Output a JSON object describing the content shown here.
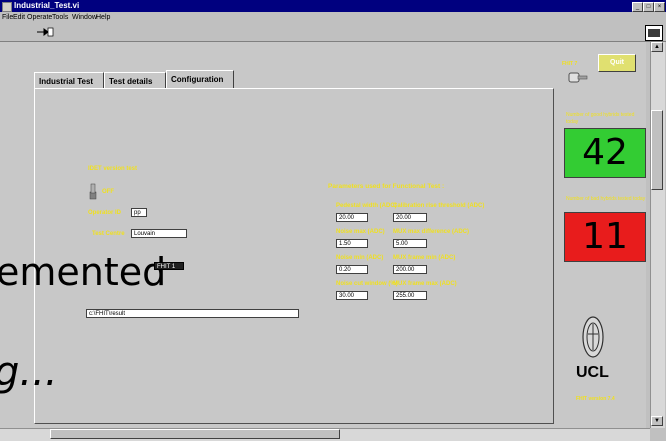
{
  "window": {
    "title": "Industrial_Test.vi"
  },
  "menu": [
    "File",
    "Edit",
    "Operate",
    "Tools",
    "Window",
    "Help"
  ],
  "tabs": [
    "Industrial Test",
    "Test details",
    "Configuration"
  ],
  "quit_label": "Quit",
  "fhit_label": "FHIT 7",
  "idet": {
    "label": "IDET version test",
    "toggle_value": "OFF"
  },
  "operator": {
    "label": "Operator ID",
    "value": "pp"
  },
  "test_centre": {
    "label": "Test Centre",
    "value": "Louvain"
  },
  "result_folder": {
    "value": "c:\\FHIT\\result",
    "tag": "FHIT 1"
  },
  "params": {
    "title": "Parameters used for Functional Test :",
    "rows": [
      {
        "left_label": "Pedestal width (ADC)",
        "left_value": "20.00",
        "right_label": "Calibration rise threshold (ADC)",
        "right_value": "20.00"
      },
      {
        "left_label": "Noise max (ADC)",
        "left_value": "1.50",
        "right_label": "MUX max difference (ADC)",
        "right_value": "5.00"
      },
      {
        "left_label": "Noise min (ADC)",
        "left_value": "0.20",
        "right_label": "MUX frame min (ADC)",
        "right_value": "200.00"
      },
      {
        "left_label": "Noise cut window (%)",
        "left_value": "30.00",
        "right_label": "MUX frame max (ADC)",
        "right_value": "255.00"
      }
    ]
  },
  "counters": [
    {
      "label": "Number of good hybrids tested today",
      "value": "42",
      "color": "#33cc33"
    },
    {
      "label": "Number of bad hybrids tested today",
      "value": "11",
      "color": "#e81c1c"
    }
  ],
  "logo": {
    "text": "UCL",
    "version": "FHIT version 7.4"
  },
  "overlay": {
    "line1": "emented",
    "line2": "g..."
  }
}
